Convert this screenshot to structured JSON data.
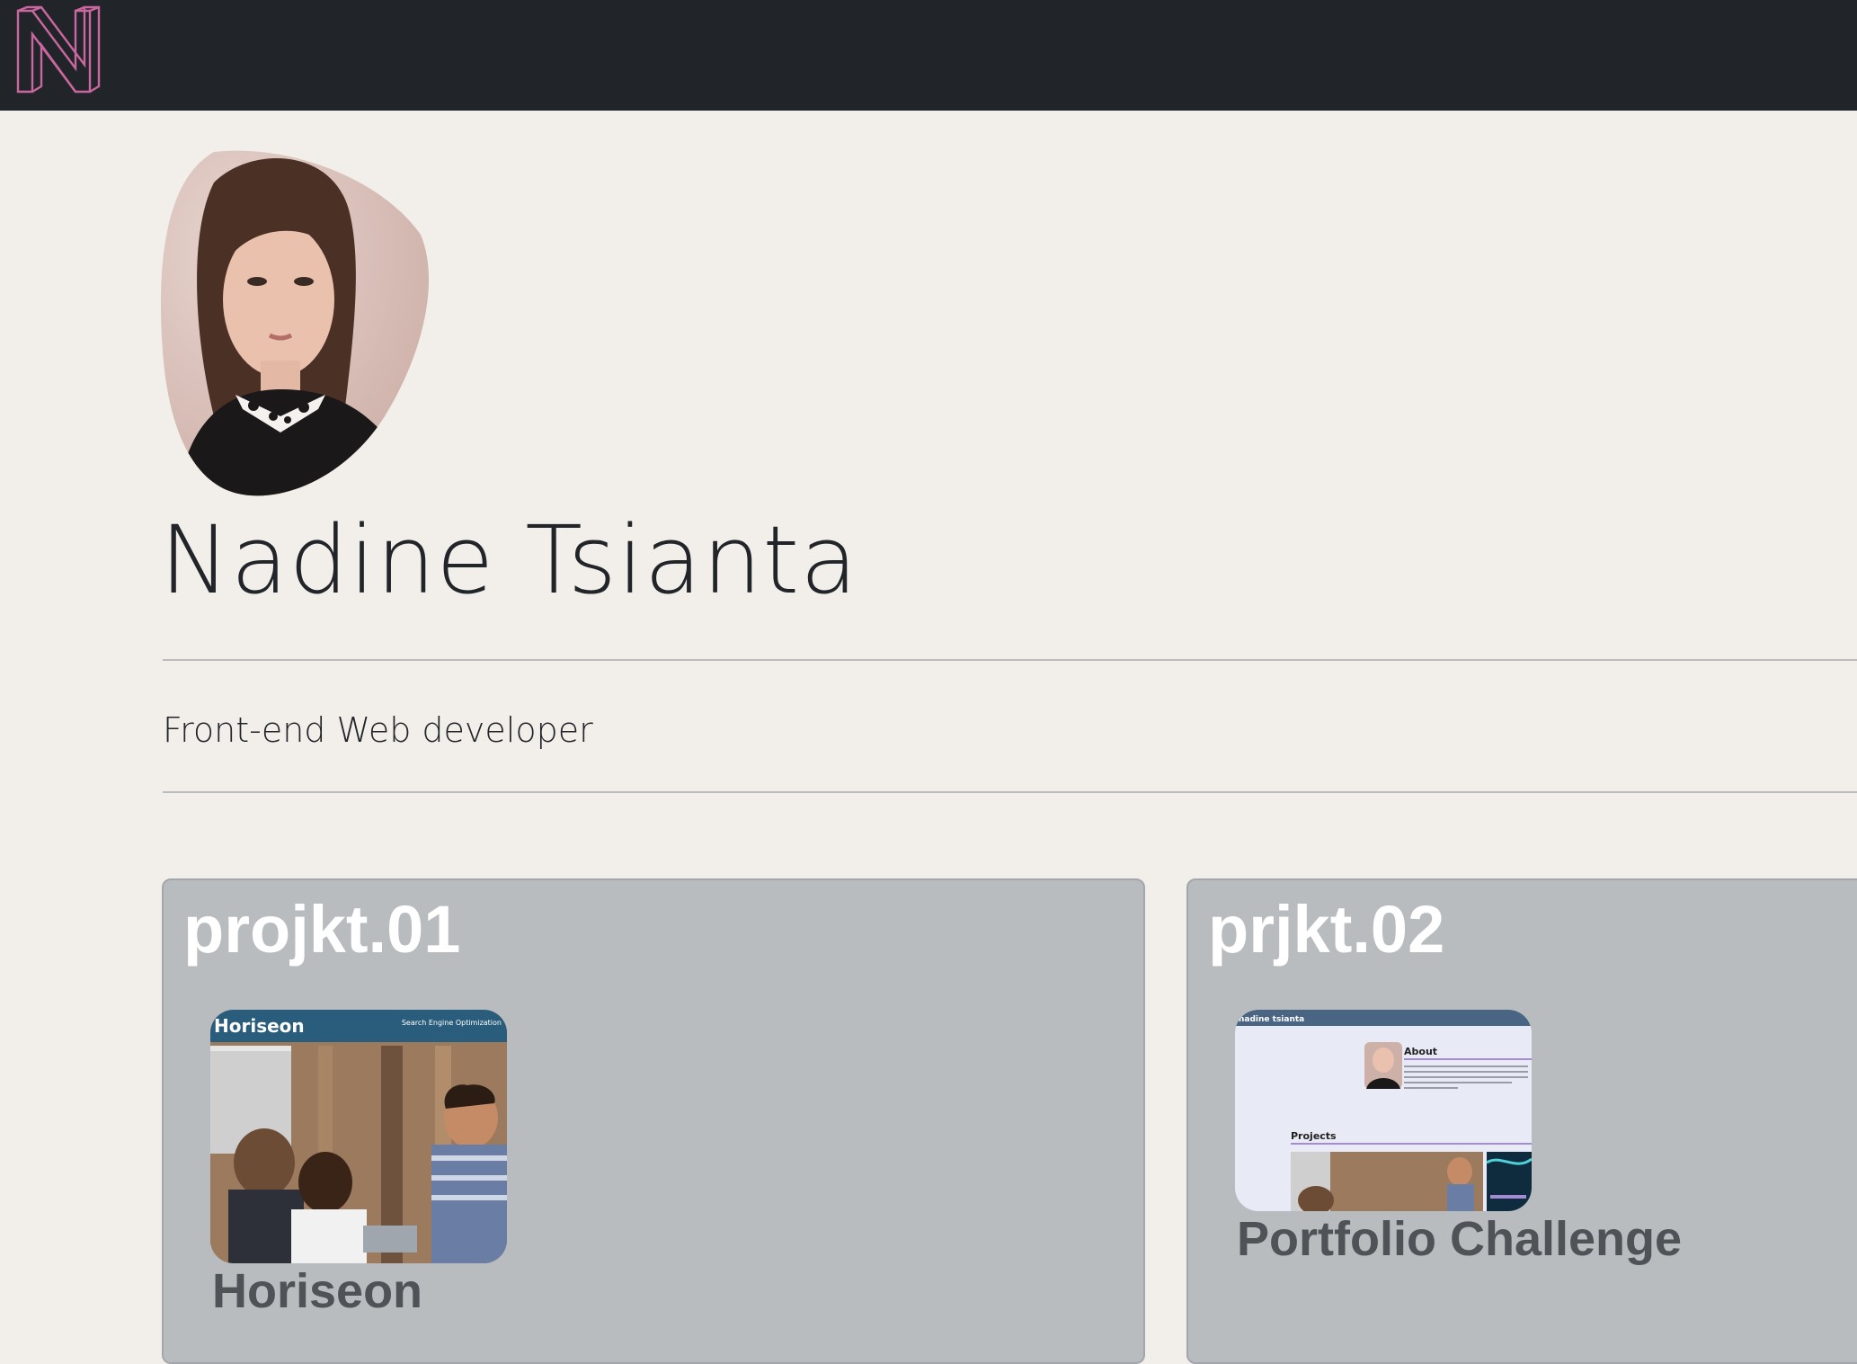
{
  "nav": {
    "logo_icon": "n-monogram-logo-icon",
    "logo_color": "#c9679e",
    "background": "#212429"
  },
  "profile": {
    "avatar_icon": "profile-photo",
    "name": "Nadine Tsianta",
    "role": "Front-end Web developer"
  },
  "projects": [
    {
      "number": "projkt.01",
      "title": "Horiseon",
      "thumbnail": {
        "brand": "Horiseon",
        "tagline": "Search Engine Optimization"
      }
    },
    {
      "number": "prjkt.02",
      "title": "Portfolio Challenge",
      "thumbnail": {
        "site_name": "nadine tsianta",
        "about_heading": "About",
        "projects_heading": "Projects"
      }
    }
  ],
  "colors": {
    "page_background": "#f2efea",
    "card_background": "#b8bcbf",
    "card_heading": "#ffffff",
    "project_title": "#4f5358",
    "horiseon_header": "#2a5d7c",
    "portfolio_header": "#4a6583",
    "portfolio_accent": "#a58ad6"
  }
}
